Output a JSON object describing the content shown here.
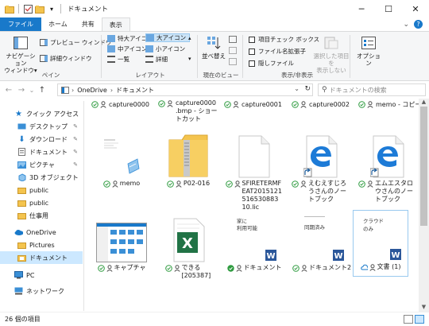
{
  "window": {
    "title": "ドキュメント",
    "qat_separator": "|",
    "qat_dropdown": "▾",
    "minimize": "─",
    "maximize": "☐",
    "close": "✕"
  },
  "tabs": [
    {
      "label": "ファイル"
    },
    {
      "label": "ホーム"
    },
    {
      "label": "共有"
    },
    {
      "label": "表示"
    }
  ],
  "tab_right": {
    "collapse": "⌄",
    "help": "?"
  },
  "ribbon": {
    "pane": {
      "nav_pane_line1": "ナビゲーション",
      "nav_pane_line2": "ウィンドウ▾",
      "preview": "プレビュー ウィンドウ",
      "details": "詳細ウィンドウ",
      "label": "ペイン"
    },
    "layout": {
      "extra_large": "特大アイコン",
      "large": "大アイコン",
      "medium": "中アイコン",
      "small": "小アイコン",
      "list": "一覧",
      "details": "詳細",
      "label": "レイアウト"
    },
    "current_view": {
      "sort": "並べ替え",
      "label": "現在のビュー"
    },
    "show_hide": {
      "item_checkboxes": "項目チェック ボックス",
      "file_extensions": "ファイル名拡張子",
      "hidden_items": "隠しファイル",
      "hide_selected_line1": "選択した項目を",
      "hide_selected_line2": "表示しない",
      "label": "表示/非表示"
    },
    "options": {
      "label": "オプション"
    }
  },
  "address": {
    "back": "←",
    "forward": "→",
    "recent": "⌄",
    "up": "↑",
    "path_sep": "›",
    "crumb1": "OneDrive",
    "crumb2": "ドキュメント",
    "dropdown": "⌄",
    "refresh": "↻",
    "search_placeholder": "ドキュメントの検索",
    "search_icon": "⚲"
  },
  "nav": {
    "quick_access": "クイック アクセス",
    "desktop": "デスクトップ",
    "downloads": "ダウンロード",
    "documents": "ドキュメント",
    "pictures": "ピクチャ",
    "objects3d": "3D オブジェクト",
    "public1": "public",
    "public2": "public",
    "work": "仕事用",
    "onedrive": "OneDrive",
    "od_pictures": "Pictures",
    "od_documents": "ドキュメント",
    "pc": "PC",
    "network": "ネットワーク",
    "pin": "📌",
    "expand": "›"
  },
  "top_row": [
    {
      "name": "capture0000"
    },
    {
      "name1": "capture0000",
      "name2": ".bmp - ショー",
      "name3": "トカット"
    },
    {
      "name": "capture0001"
    },
    {
      "name": "capture0002"
    },
    {
      "name": "memo - コピー"
    }
  ],
  "tiles": [
    {
      "name": "memo"
    },
    {
      "name": "P02-016"
    },
    {
      "name": "SFIRETERMFEAT2015121516530883 10.lic"
    },
    {
      "name": "えむえすじろうさんのノートブック"
    },
    {
      "name": "エムエスタロウさんのノートブック"
    },
    {
      "name": "キャプチャ"
    },
    {
      "name": "できる [205387]"
    },
    {
      "name": "ドキュメント",
      "thumb_line1": "家に",
      "thumb_line2": "利用可能"
    },
    {
      "name": "ドキュメント2",
      "thumb_line1": "同期済み"
    },
    {
      "name": "文書 (1)",
      "thumb_line1": "クラウド",
      "thumb_line2": "のみ"
    }
  ],
  "status": {
    "count": "26 個の項目"
  },
  "colors": {
    "accent": "#1979ca",
    "selected": "#cce8ff",
    "sync_green": "#2e9b3f",
    "folder": "#f4c44e",
    "word": "#2b579a",
    "excel": "#217346",
    "edge": "#1d7bd7"
  }
}
